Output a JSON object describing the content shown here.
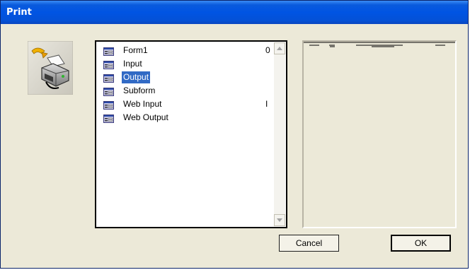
{
  "window": {
    "title": "Print"
  },
  "list": {
    "items": [
      {
        "label": "Form1",
        "extra": "0"
      },
      {
        "label": "Input",
        "extra": ""
      },
      {
        "label": "Output",
        "extra": ""
      },
      {
        "label": "Subform",
        "extra": ""
      },
      {
        "label": "Web Input",
        "extra": "I"
      },
      {
        "label": "Web Output",
        "extra": ""
      }
    ],
    "selected_index": 2
  },
  "buttons": {
    "cancel": "Cancel",
    "ok": "OK"
  },
  "icons": {
    "printer": "printer-icon",
    "form": "form-icon",
    "scroll_up": "scroll-up-icon",
    "scroll_down": "scroll-down-icon"
  },
  "colors": {
    "title_bar": "#0054e3",
    "selection": "#316ac5",
    "window_bg": "#ece9d8"
  }
}
